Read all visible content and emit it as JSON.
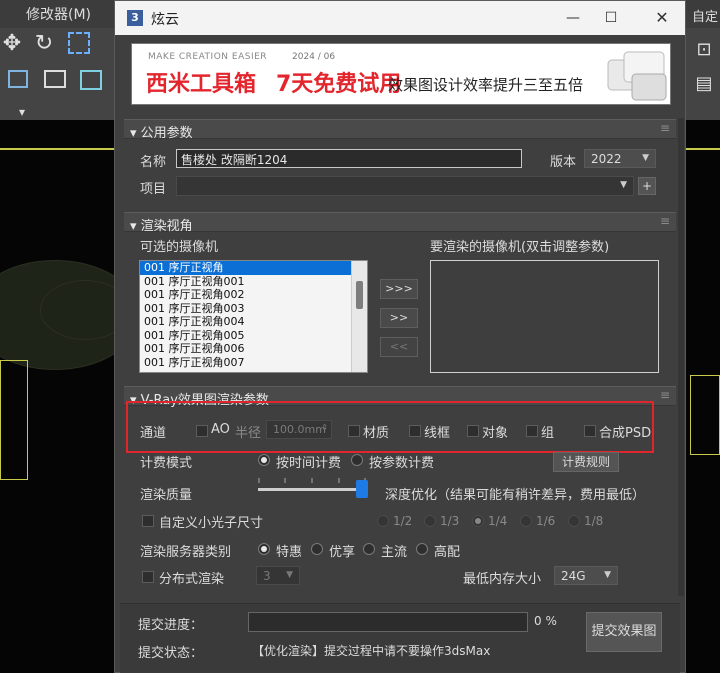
{
  "background": {
    "menu_left": "修改器(M)",
    "menu_right": "自定"
  },
  "dialog": {
    "title": "炫云",
    "icon_glyph": "3",
    "min_glyph": "—",
    "max_glyph": "☐",
    "close_glyph": "✕"
  },
  "banner": {
    "small_text": "MAKE CREATION EASIER",
    "brand": "西米工具箱",
    "date": "2024 / 06",
    "trial": "7天免费试用",
    "slogan": "效果图设计效率提升三至五倍"
  },
  "common": {
    "section_title": "▾ 公用参数",
    "name_label": "名称",
    "name_value": "售楼处 改隔断1204",
    "version_label": "版本",
    "version_value": "2022",
    "project_label": "项目",
    "project_value": "",
    "add_label": "+"
  },
  "cameras": {
    "section_title": "▾ 渲染视角",
    "available_label": "可选的摄像机",
    "render_label": "要渲染的摄像机(双击调整参数)",
    "items": [
      "001 序厅正视角",
      "001 序厅正视角001",
      "001 序厅正视角002",
      "001 序厅正视角003",
      "001 序厅正视角004",
      "001 序厅正视角005",
      "001 序厅正视角006",
      "001 序厅正视角007"
    ],
    "btn_add_all": ">>>",
    "btn_add": ">>",
    "btn_remove": "<<"
  },
  "vray": {
    "section_title": "▾ V-Ray效果图渲染参数",
    "channel_label": "通道",
    "ao_label": "AO",
    "radius_label": "半径",
    "radius_value": "100.0mm",
    "material_label": "材质",
    "wireframe_label": "线框",
    "object_label": "对象",
    "group_label": "组",
    "psd_label": "合成PSD",
    "billing_label": "计费模式",
    "billing_time": "按时间计费",
    "billing_param": "按参数计费",
    "billing_rules": "计费规则",
    "quality_label": "渲染质量",
    "quality_desc": "深度优化（结果可能有稍许差异，费用最低）",
    "custom_photon_label": "自定义小光子尺寸",
    "fractions": [
      "1/2",
      "1/3",
      "1/4",
      "1/6",
      "1/8"
    ],
    "server_label": "渲染服务器类别",
    "server_options": [
      "特惠",
      "优享",
      "主流",
      "高配"
    ],
    "distributed_label": "分布式渲染",
    "distributed_value": "3",
    "min_memory_label": "最低内存大小",
    "min_memory_value": "24G"
  },
  "submit": {
    "progress_label": "提交进度：",
    "progress_value": "0 %",
    "status_label": "提交状态：",
    "status_text": "【优化渲染】提交过程中请不要操作3dsMax",
    "submit_button": "提交效果图"
  }
}
